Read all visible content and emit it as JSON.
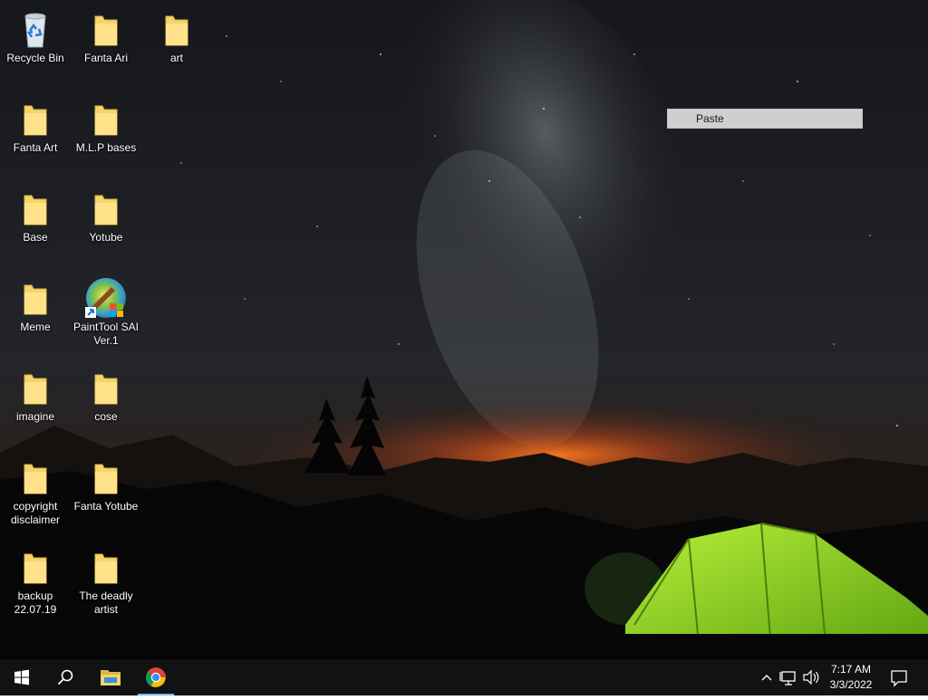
{
  "desktop": {
    "icons": [
      {
        "label": "Recycle Bin",
        "type": "recycle-bin"
      },
      {
        "label": "Fanta Ari",
        "type": "folder"
      },
      {
        "label": "art",
        "type": "folder"
      },
      {
        "label": "Fanta Art",
        "type": "folder"
      },
      {
        "label": "M.L.P bases",
        "type": "folder"
      },
      {
        "label": "Base",
        "type": "folder"
      },
      {
        "label": "Yotube",
        "type": "folder"
      },
      {
        "label": "Meme",
        "type": "folder"
      },
      {
        "label": "PaintTool SAI Ver.1",
        "type": "shortcut"
      },
      {
        "label": "imagine",
        "type": "folder"
      },
      {
        "label": "cose",
        "type": "folder"
      },
      {
        "label": "copyright disclaimer",
        "type": "folder"
      },
      {
        "label": "Fanta Yotube",
        "type": "folder"
      },
      {
        "label": "backup 22.07.19",
        "type": "folder"
      },
      {
        "label": "The deadly artist",
        "type": "folder"
      }
    ]
  },
  "context_menu": {
    "items": [
      {
        "label": "Paste"
      }
    ]
  },
  "taskbar": {
    "start_icon": "windows-logo-icon",
    "search_icon": "search-icon",
    "pinned": [
      {
        "name": "File Explorer",
        "icon": "file-explorer-icon"
      },
      {
        "name": "Google Chrome",
        "icon": "chrome-icon",
        "active": true
      }
    ],
    "tray": {
      "icons": [
        "chevron-up-icon",
        "network-icon",
        "volume-icon"
      ],
      "time": "7:17 AM",
      "date": "3/3/2022",
      "notification_icon": "action-center-icon"
    }
  },
  "colors": {
    "taskbar_bg": "#101214",
    "active_indicator": "#76b9ed",
    "folder_yellow": "#f5d46b",
    "context_menu_bg": "#cfcfcf"
  }
}
